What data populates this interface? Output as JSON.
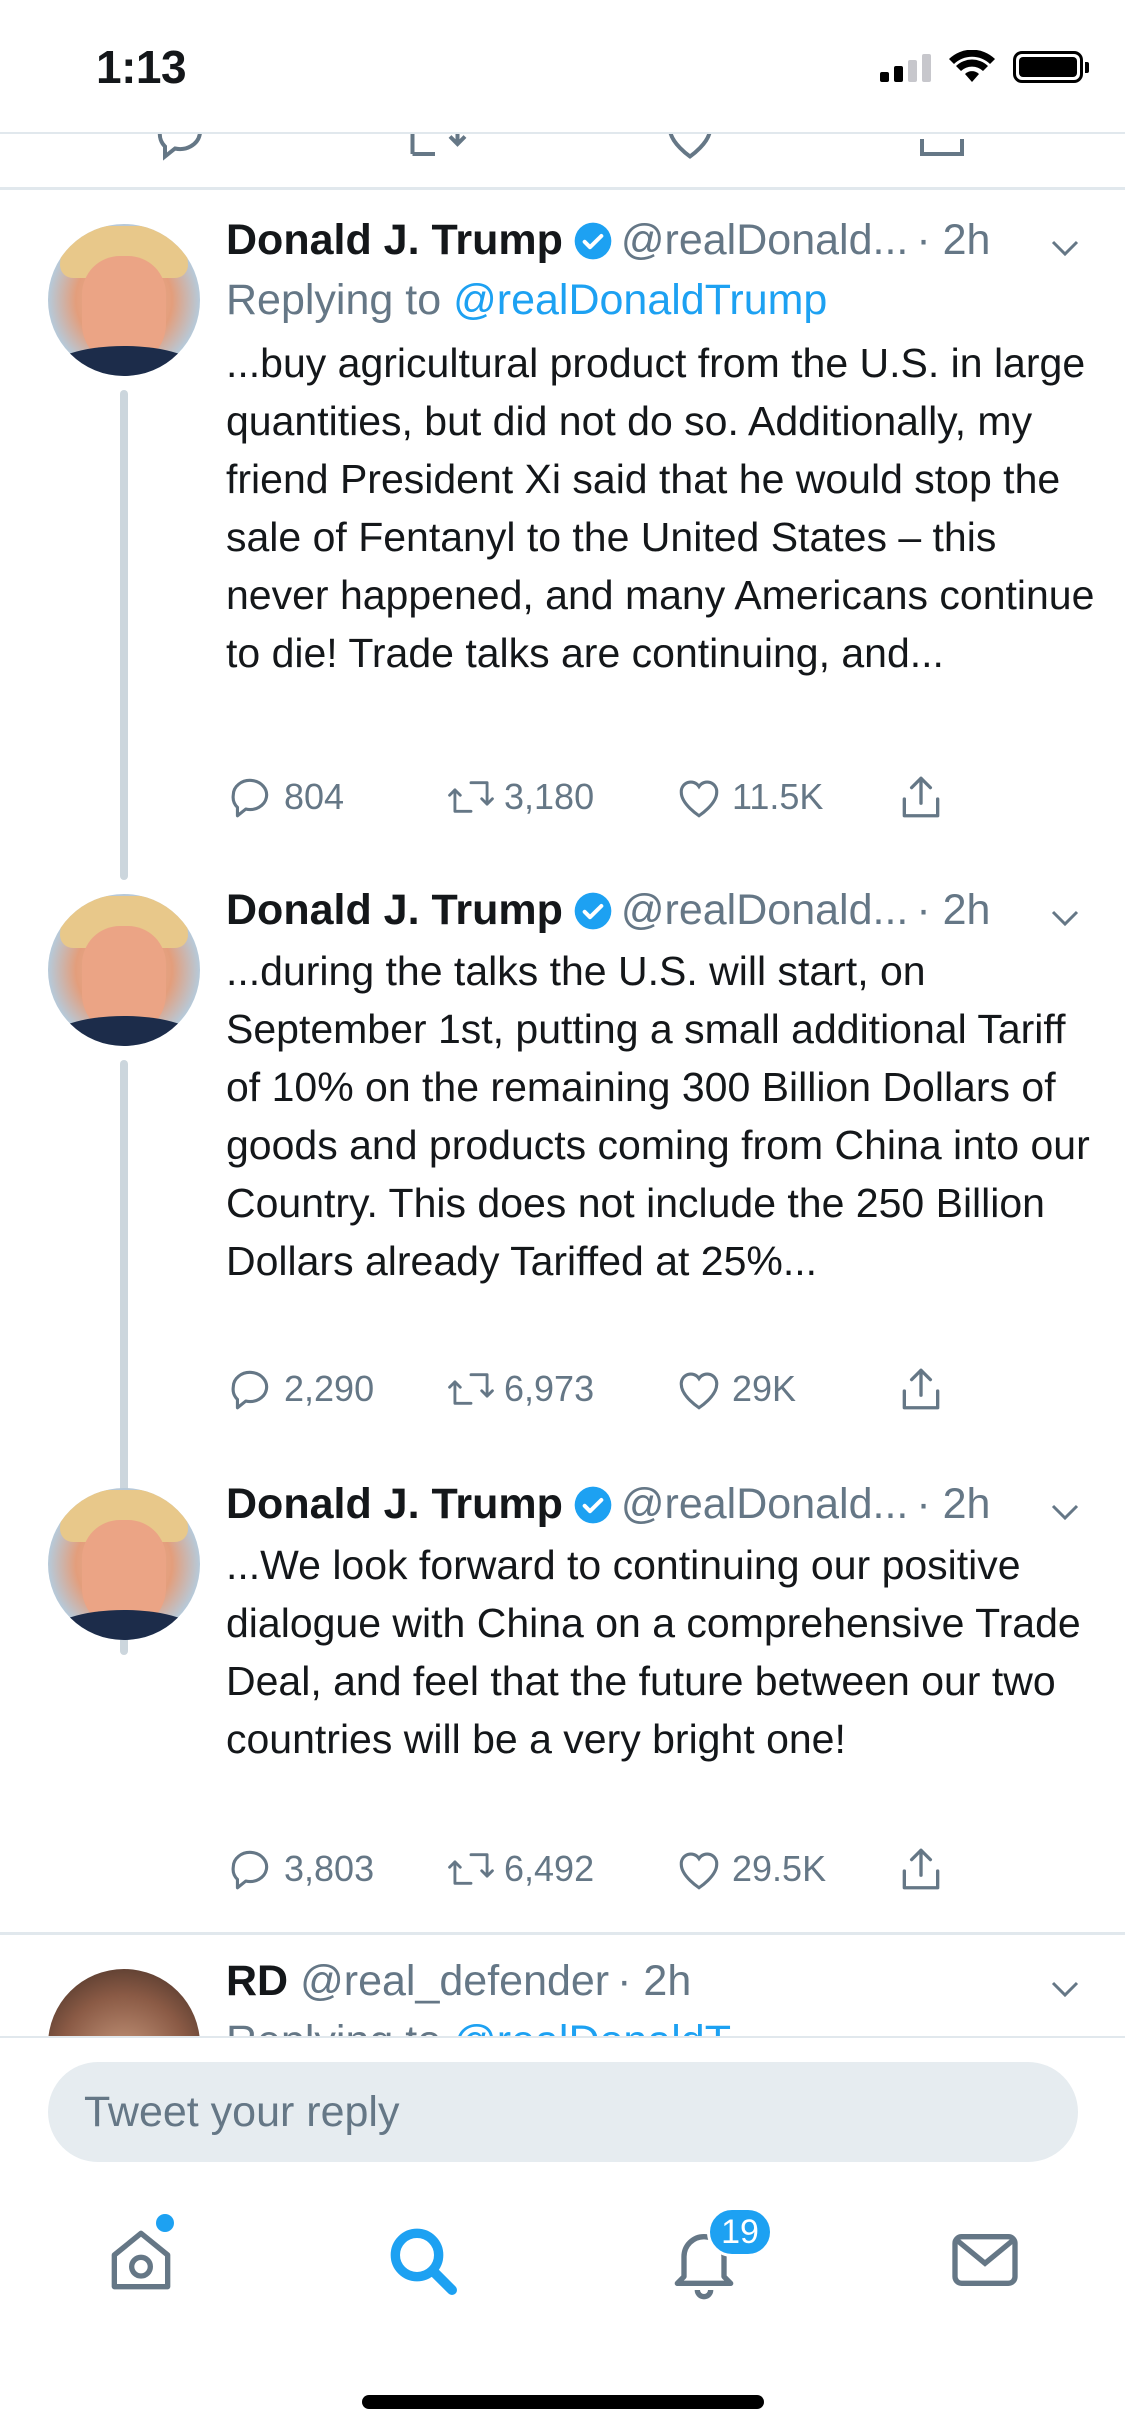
{
  "status_bar": {
    "time": "1:13"
  },
  "tweets": [
    {
      "name": "Donald J. Trump",
      "handle": "@realDonald...",
      "time": "· 2h",
      "replying_prefix": "Replying to",
      "replying_to": "@realDonaldTrump",
      "text": "...buy agricultural product from the U.S. in large quantities, but did not do so. Additionally, my friend President Xi said that he would stop the sale of Fentanyl to the United States – this never happened, and many Americans continue to die! Trade talks are continuing, and...",
      "replies": "804",
      "retweets": "3,180",
      "likes": "11.5K"
    },
    {
      "name": "Donald J. Trump",
      "handle": "@realDonald...",
      "time": "· 2h",
      "text": "...during the talks the U.S. will start, on September 1st, putting a small additional Tariff of 10% on the remaining 300 Billion Dollars of goods and products coming from China into our Country. This does not include the 250 Billion Dollars already Tariffed at 25%...",
      "replies": "2,290",
      "retweets": "6,973",
      "likes": "29K"
    },
    {
      "name": "Donald J. Trump",
      "handle": "@realDonald...",
      "time": "· 2h",
      "text": "...We look forward to continuing our positive dialogue with China on a comprehensive Trade Deal, and feel that the future between our two countries will be a very bright one!",
      "replies": "3,803",
      "retweets": "6,492",
      "likes": "29.5K"
    },
    {
      "name": "RD",
      "handle": "@real_defender",
      "time": "· 2h",
      "replying_prefix": "Replying to",
      "replying_to": "@realDonaldT..."
    }
  ],
  "composer": {
    "placeholder": "Tweet your reply"
  },
  "tabbar": {
    "notifications_badge": "19",
    "items": [
      "home-icon",
      "search-icon",
      "notifications-icon",
      "messages-icon"
    ]
  },
  "colors": {
    "accent": "#1da1f2",
    "muted": "#657786",
    "divider": "#e1e8ed"
  }
}
